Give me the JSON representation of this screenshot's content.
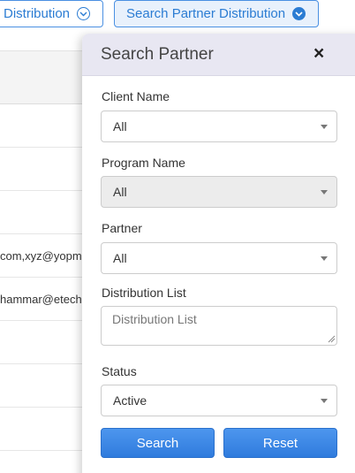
{
  "toolbar": {
    "distribution_label": "Distribution",
    "search_partner_distribution_label": "Search Partner Distribution"
  },
  "table": {
    "rows": [
      "",
      "",
      "",
      "com,xyz@yopmail.com",
      "hammar@etechaces.com",
      "",
      "",
      "",
      ""
    ]
  },
  "panel": {
    "title": "Search Partner",
    "close_symbol": "×",
    "fields": {
      "client_name": {
        "label": "Client Name",
        "value": "All"
      },
      "program_name": {
        "label": "Program Name",
        "value": "All"
      },
      "partner": {
        "label": "Partner",
        "value": "All"
      },
      "distribution_list": {
        "label": "Distribution List",
        "placeholder": "Distribution List"
      },
      "status": {
        "label": "Status",
        "value": "Active"
      }
    },
    "buttons": {
      "search": "Search",
      "reset": "Reset"
    }
  },
  "colors": {
    "accent": "#2b7cd3",
    "button_blue": "#3a86e6",
    "panel_header": "#e8e7f2"
  },
  "icons": {
    "distribution_toggle": "chevron-down-circle-icon",
    "search_distribution_toggle": "chevron-down-circle-filled-icon",
    "close": "close-icon",
    "select_caret": "caret-down-icon"
  }
}
